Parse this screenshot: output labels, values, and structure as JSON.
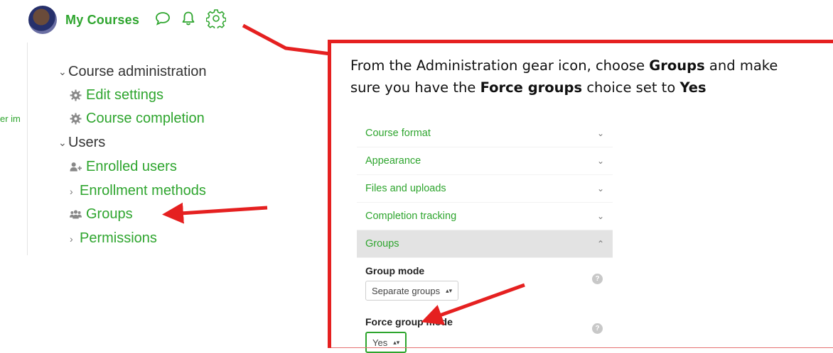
{
  "header": {
    "title": "My Courses",
    "icons": [
      "avatar",
      "chat-bubble-icon",
      "bell-icon",
      "gear-icon"
    ]
  },
  "cutoff_text": "er im",
  "nav": {
    "course_admin": "Course administration",
    "edit_settings": "Edit settings",
    "course_completion": "Course completion",
    "users": "Users",
    "enrolled_users": "Enrolled users",
    "enrollment_methods": "Enrollment methods",
    "groups": "Groups",
    "permissions": "Permissions"
  },
  "instruction": {
    "part1": "From the Administration gear icon, choose ",
    "groups": "Groups",
    "part2": " and make sure you have the ",
    "force_groups": "Force groups",
    "part3": " choice set to ",
    "yes": "Yes"
  },
  "settings": {
    "rows": [
      "Course format",
      "Appearance",
      "Files and uploads",
      "Completion tracking"
    ],
    "active_row": "Groups",
    "group_mode_label": "Group mode",
    "group_mode_value": "Separate groups",
    "force_group_mode_label": "Force group mode",
    "force_group_mode_value": "Yes"
  },
  "colors": {
    "accent_green": "#2ea52e",
    "annotation_red": "#e52020"
  }
}
